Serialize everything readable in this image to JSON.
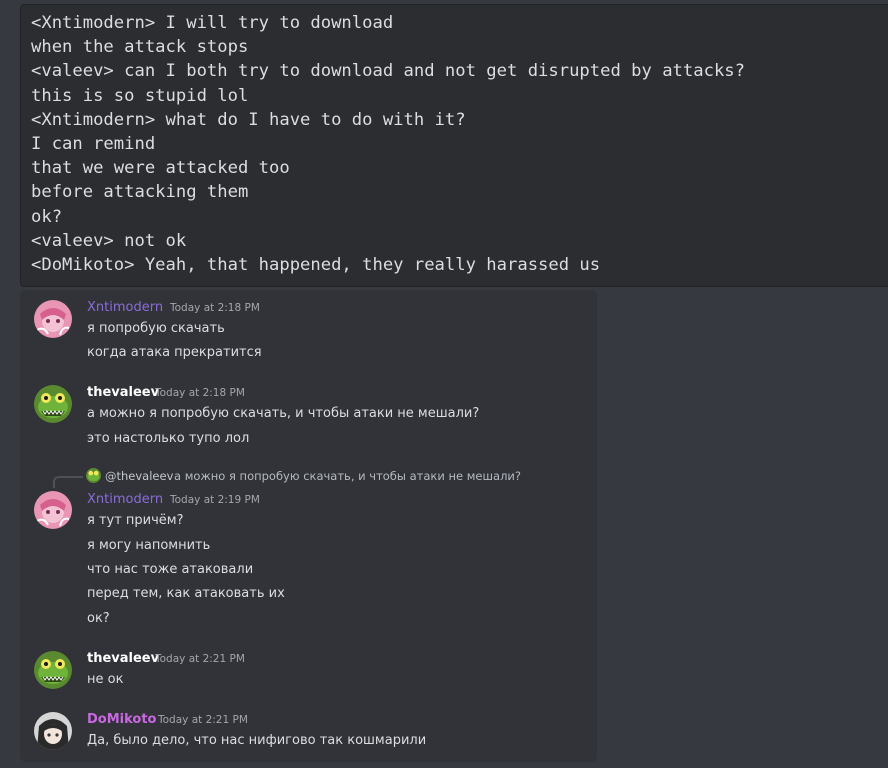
{
  "code_block": {
    "lines": [
      "<Xntimodern> I will try to download",
      "when the attack stops",
      "<valeev> can I both try to download and not get disrupted by attacks?",
      "this is so stupid lol",
      "<Xntimodern> what do I have to do with it?",
      "I can remind",
      "that we were attacked too",
      "before attacking them",
      "ok?",
      "<valeev> not ok",
      "<DoMikoto> Yeah, that happened, they really harassed us"
    ]
  },
  "chat": {
    "messages": [
      {
        "username": "Xntimodern",
        "timestamp": "Today at 2:18 PM",
        "lines": [
          "я попробую скачать",
          "когда атака прекратится"
        ]
      },
      {
        "username": "thevaleev",
        "timestamp": "Today at 2:18 PM",
        "lines": [
          "а можно я попробую скачать, и чтобы атаки не мешали?",
          "это настолько тупо лол"
        ]
      },
      {
        "reply": {
          "username": "@thevaleev",
          "text": "а можно я попробую скачать, и чтобы атаки не мешали?"
        },
        "username": "Xntimodern",
        "timestamp": "Today at 2:19 PM",
        "lines": [
          "я тут причём?",
          "я могу напомнить",
          "что нас тоже атаковали",
          "перед тем, как атаковать их",
          "ок?"
        ]
      },
      {
        "username": "thevaleev",
        "timestamp": "Today at 2:21 PM",
        "lines": [
          "не ок"
        ]
      },
      {
        "username": "DoMikoto",
        "timestamp": "Today at 2:21 PM",
        "lines": [
          "Да, было дело, что нас нифигово так кошмарили"
        ]
      }
    ]
  },
  "colors": {
    "background": "#36393f",
    "code_background": "#2b2d31",
    "chat_background": "#313338",
    "xntimodern_name": "#8c6bd9",
    "thevaleev_name": "#ffffff",
    "domikoto_name": "#c968e0"
  },
  "icons": {
    "xntimodern_avatar": "pink-anime-avatar-icon",
    "thevaleev_avatar": "green-crocodile-avatar-icon",
    "domikoto_avatar": "anime-girl-avatar-icon"
  }
}
